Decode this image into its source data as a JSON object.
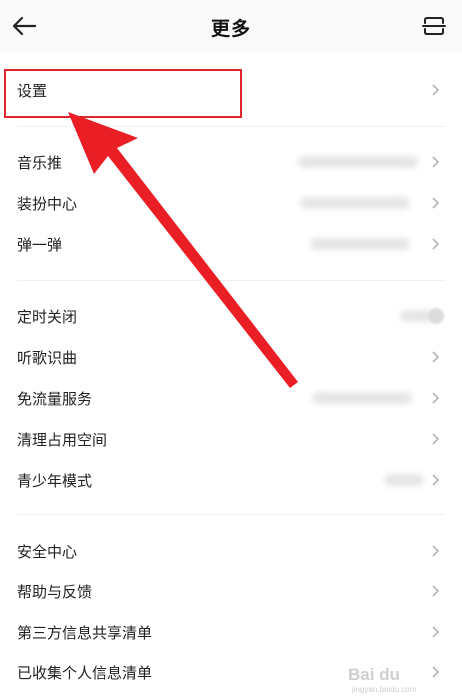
{
  "header": {
    "title": "更多"
  },
  "groups": [
    {
      "items": [
        {
          "label": "设置"
        }
      ]
    },
    {
      "items": [
        {
          "label": "音乐推"
        },
        {
          "label": "装扮中心"
        },
        {
          "label": "弹一弹"
        }
      ]
    },
    {
      "items": [
        {
          "label": "定时关闭"
        },
        {
          "label": "听歌识曲"
        },
        {
          "label": "免流量服务"
        },
        {
          "label": "清理占用空间"
        },
        {
          "label": "青少年模式"
        }
      ]
    },
    {
      "items": [
        {
          "label": "安全中心"
        },
        {
          "label": "帮助与反馈"
        },
        {
          "label": "第三方信息共享清单"
        },
        {
          "label": "已收集个人信息清单"
        }
      ]
    }
  ],
  "annotation": {
    "color": "#e0272e"
  },
  "watermark": {
    "text": "Bai du",
    "subtext": "jingyan.baidu.com"
  }
}
